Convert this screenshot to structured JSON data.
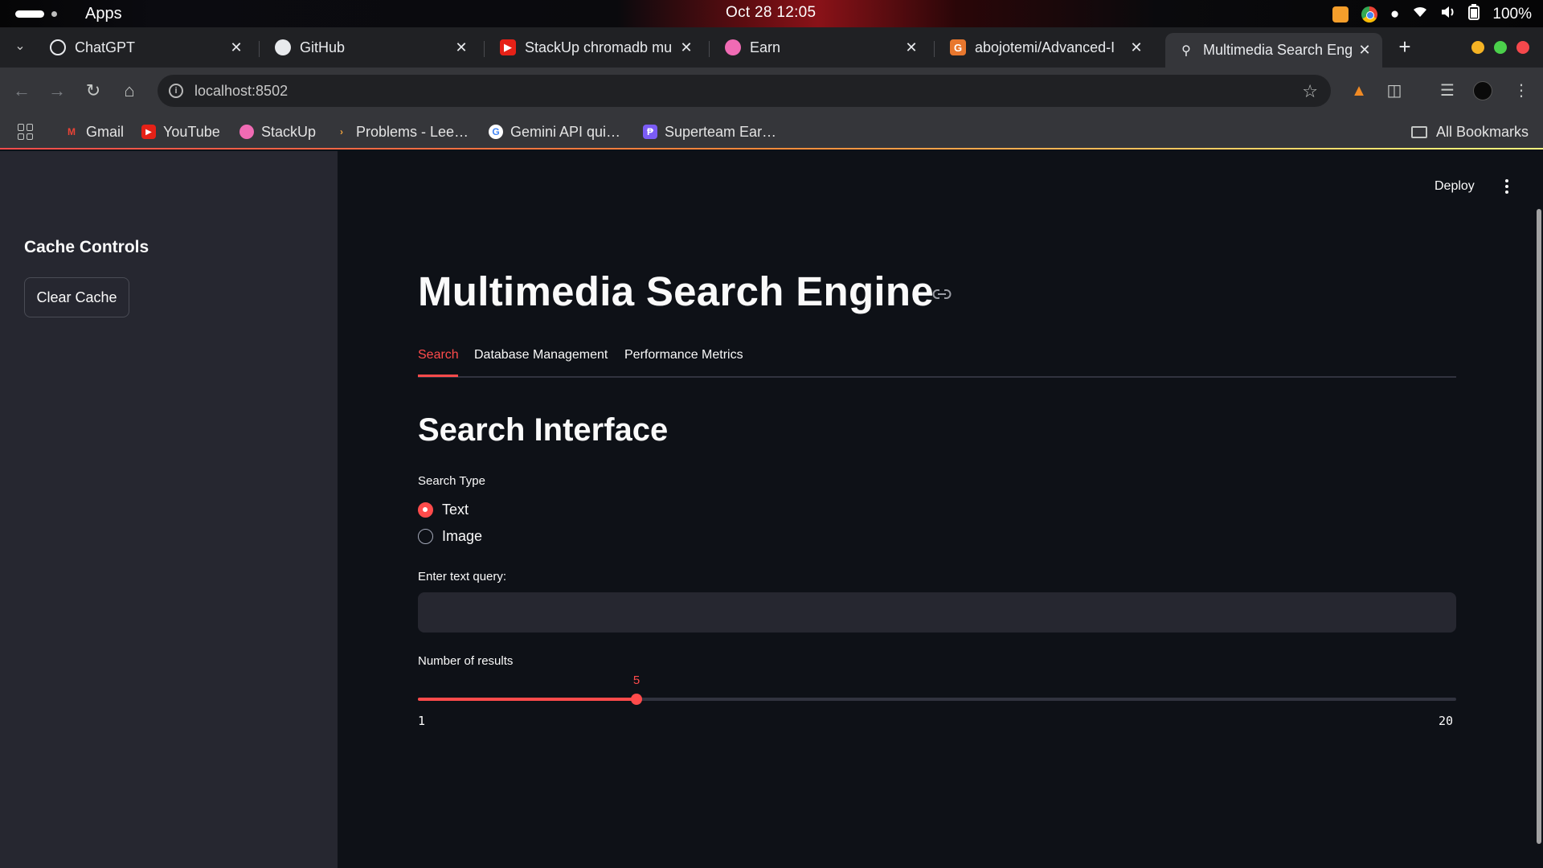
{
  "os_bar": {
    "apps_label": "Apps",
    "clock": "Oct 28  12:05",
    "battery": "100%"
  },
  "browser": {
    "tabs": [
      {
        "title": "ChatGPT",
        "icon": "chatgpt-icon"
      },
      {
        "title": "GitHub",
        "icon": "github-icon"
      },
      {
        "title": "StackUp chromadb mu",
        "icon": "youtube-icon"
      },
      {
        "title": "Earn",
        "icon": "earn-icon"
      },
      {
        "title": "abojotemi/Advanced-I",
        "icon": "gitlab-icon"
      },
      {
        "title": "Multimedia Search Eng",
        "icon": "search-icon",
        "active": true
      }
    ],
    "url": "localhost:8502",
    "bookmarks": [
      {
        "label": "Gmail",
        "icon": "gmail-icon"
      },
      {
        "label": "YouTube",
        "icon": "youtube-icon"
      },
      {
        "label": "StackUp",
        "icon": "stackup-icon"
      },
      {
        "label": "Problems - Lee…",
        "icon": "leetcode-icon"
      },
      {
        "label": "Gemini API qui…",
        "icon": "google-icon"
      },
      {
        "label": "Superteam Ear…",
        "icon": "superteam-icon"
      }
    ],
    "all_bookmarks_label": "All Bookmarks"
  },
  "sidebar": {
    "heading": "Cache Controls",
    "clear_cache_label": "Clear Cache"
  },
  "header": {
    "deploy_label": "Deploy"
  },
  "main": {
    "title": "Multimedia Search Engine",
    "tabs": [
      {
        "label": "Search",
        "active": true
      },
      {
        "label": "Database Management",
        "active": false
      },
      {
        "label": "Performance Metrics",
        "active": false
      }
    ],
    "section_title": "Search Interface",
    "search_type": {
      "label": "Search Type",
      "options": [
        "Text",
        "Image"
      ],
      "selected": "Text"
    },
    "query": {
      "label": "Enter text query:",
      "value": "",
      "placeholder": ""
    },
    "num_results": {
      "label": "Number of results",
      "value": 5,
      "value_text": "5",
      "min": 1,
      "min_text": "1",
      "max": 20,
      "max_text": "20"
    }
  },
  "colors": {
    "accent": "#ff4b4b",
    "sidebar_bg": "#262730",
    "main_bg": "#0e1117"
  }
}
